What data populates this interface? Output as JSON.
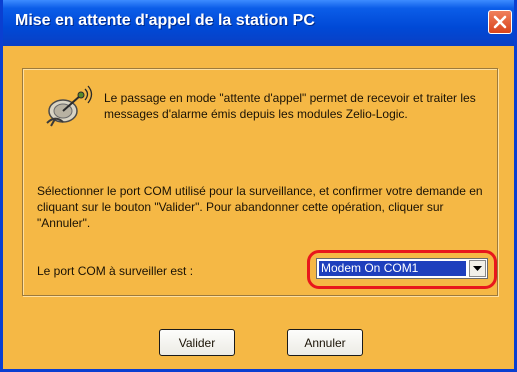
{
  "window": {
    "title": "Mise en attente d'appel de la station PC"
  },
  "dialog": {
    "intro_text": "Le passage en mode \"attente d'appel\" permet de recevoir et traiter les messages d'alarme émis depuis les modules Zelio-Logic.",
    "instruction_text": "Sélectionner le port COM utilisé pour la surveillance, et confirmer votre demande en cliquant sur le bouton \"Valider\". Pour abandonner cette opération, cliquer sur \"Annuler\".",
    "port_label": "Le port COM à surveiller est :",
    "port_select": {
      "selected": "Modem On COM1"
    }
  },
  "buttons": {
    "ok_label": "Valider",
    "cancel_label": "Annuler"
  },
  "icons": {
    "close": "close-icon",
    "dialog": "satellite-dish-icon",
    "dropdown": "chevron-down-icon"
  },
  "colors": {
    "titlebar": "#0049d6",
    "background": "#f5b845",
    "highlight": "#e8171c",
    "selection": "#1e3fbd"
  }
}
